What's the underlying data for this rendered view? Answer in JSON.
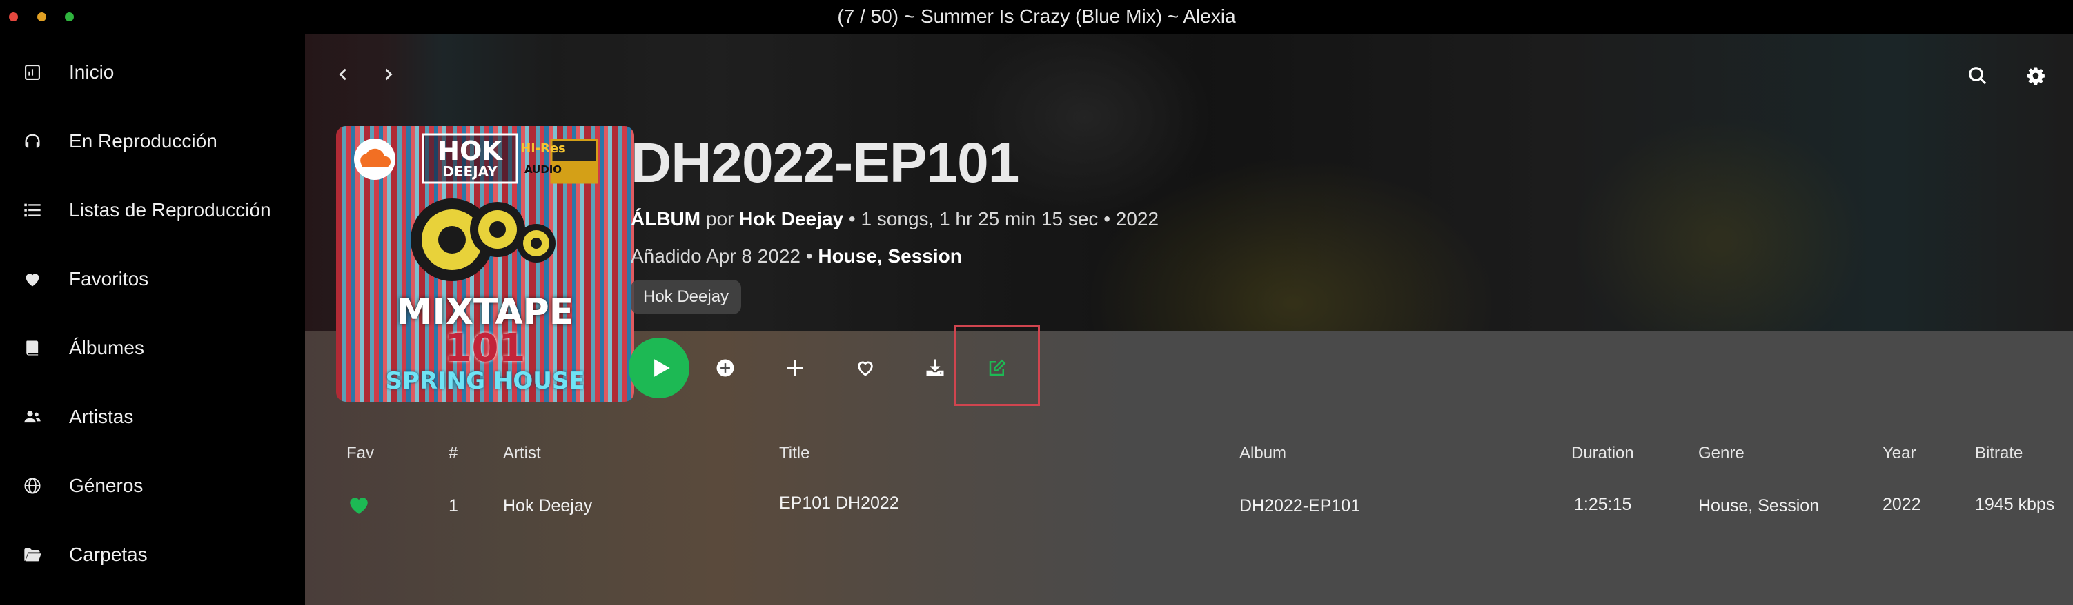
{
  "window": {
    "title": "(7 / 50) ~ Summer Is Crazy (Blue Mix) ~ Alexia"
  },
  "sidebar": {
    "items": [
      {
        "label": "Inicio",
        "icon": "home-icon"
      },
      {
        "label": "En Reproducción",
        "icon": "headphones-icon"
      },
      {
        "label": "Listas de Reproducción",
        "icon": "list-icon"
      },
      {
        "label": "Favoritos",
        "icon": "heart-icon"
      },
      {
        "label": "Álbumes",
        "icon": "book-icon"
      },
      {
        "label": "Artistas",
        "icon": "users-icon"
      },
      {
        "label": "Géneros",
        "icon": "globe-icon"
      },
      {
        "label": "Carpetas",
        "icon": "folder-icon"
      }
    ]
  },
  "album": {
    "title": "DH2022-EP101",
    "type_label": "ÁLBUM",
    "by_word": "por",
    "artist": "Hok Deejay",
    "stats": "• 1 songs, 1 hr 25 min 15 sec • 2022",
    "added": "Añadido Apr 8 2022 •",
    "genres": "House, Session",
    "artist_chip": "Hok Deejay",
    "cover": {
      "logo_text": "HOK",
      "logo_sub": "DEEJAY",
      "hires": "Hi-Res",
      "hires_sub": "AUDIO",
      "title": "MIXTAPE",
      "number": "101",
      "subtitle": "SPRING HOUSE"
    }
  },
  "table": {
    "headers": {
      "fav": "Fav",
      "num": "#",
      "artist": "Artist",
      "title": "Title",
      "album": "Album",
      "duration": "Duration",
      "genre": "Genre",
      "year": "Year",
      "bitrate": "Bitrate"
    },
    "rows": [
      {
        "num": "1",
        "artist": "Hok Deejay",
        "title": "EP101 DH2022",
        "album": "DH2022-EP101",
        "duration": "1:25:15",
        "genre": "House, Session",
        "year": "2022",
        "bitrate": "1945 kbps",
        "favorite": true
      }
    ]
  },
  "colors": {
    "accent": "#1db954",
    "highlight": "#d0454f",
    "background": "#000000"
  }
}
